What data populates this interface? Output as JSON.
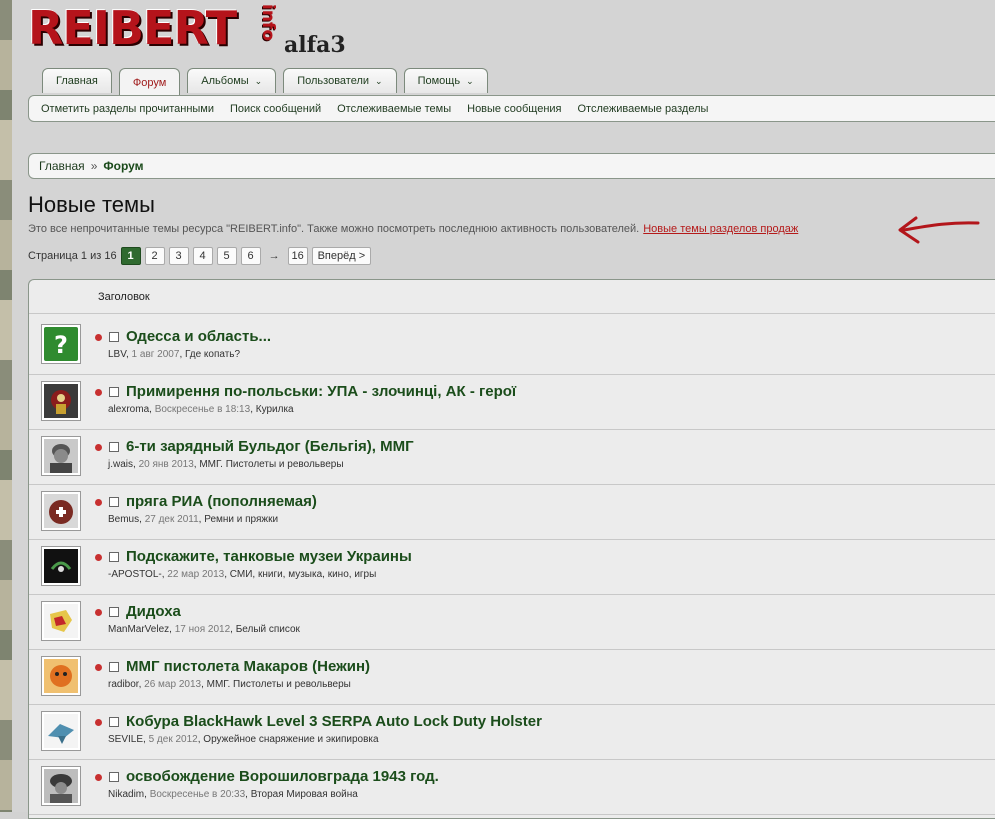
{
  "header": {
    "logo_main": "REIBERT",
    "logo_suffix": "info",
    "logo_tag": "alfa3"
  },
  "tabs": [
    {
      "label": "Главная",
      "dropdown": false,
      "active": false
    },
    {
      "label": "Форум",
      "dropdown": false,
      "active": true
    },
    {
      "label": "Альбомы",
      "dropdown": true,
      "active": false
    },
    {
      "label": "Пользователи",
      "dropdown": true,
      "active": false
    },
    {
      "label": "Помощь",
      "dropdown": true,
      "active": false
    }
  ],
  "subnav": [
    "Отметить разделы прочитанными",
    "Поиск сообщений",
    "Отслеживаемые темы",
    "Новые сообщения",
    "Отслеживаемые разделы"
  ],
  "breadcrumb": {
    "home": "Главная",
    "separator": "»",
    "current": "Форум"
  },
  "page": {
    "title": "Новые темы",
    "description": "Это все непрочитанные темы ресурса \"REIBERT.info\". Также можно посмотреть последнюю активность пользователей.",
    "sales_link": "Новые темы разделов продаж"
  },
  "pager": {
    "label": "Страница 1 из 16",
    "pages": [
      "1",
      "2",
      "3",
      "4",
      "5",
      "6"
    ],
    "current": "1",
    "ellipsis": "→",
    "last": "16",
    "next": "Вперёд >"
  },
  "list": {
    "header": "Заголовок",
    "threads": [
      {
        "title": "Одесса и область...",
        "author": "LBV",
        "date": "1 авг 2007",
        "forum": "Где копать?",
        "avatar": "question-icon"
      },
      {
        "title": "Примирення по-польськи: УПА - злочинці, АК - герої",
        "author": "alexroma",
        "date": "Воскресенье в 18:13",
        "forum": "Курилка",
        "avatar": "emblem-avatar"
      },
      {
        "title": "6-ти зарядный Бульдог (Бельгія), ММГ",
        "author": "j.wais",
        "date": "20 янв 2013",
        "forum": "ММГ. Пистолеты и револьверы",
        "avatar": "soldier-photo-avatar"
      },
      {
        "title": "пряга РИА (пополняемая)",
        "author": "Bemus",
        "date": "27 дек 2011",
        "forum": "Ремни и пряжки",
        "avatar": "badge-avatar"
      },
      {
        "title": "Подскажите, танковые музеи Украины",
        "author": "-APOSTOL-",
        "date": "22 мар 2013",
        "forum": "СМИ, книги, музыка, кино, игры",
        "avatar": "dark-emblem-avatar"
      },
      {
        "title": "Дидоха",
        "author": "ManMarVelez",
        "date": "17 ноя 2012",
        "forum": "Белый список",
        "avatar": "map-avatar"
      },
      {
        "title": "ММГ пистолета Макаров (Нежин)",
        "author": "radibor",
        "date": "26 мар 2013",
        "forum": "ММГ. Пистолеты и револьверы",
        "avatar": "cartoon-avatar"
      },
      {
        "title": "Кобура BlackHawk Level 3 SERPA Auto Lock Duty Holster",
        "author": "SEVILE",
        "date": "5 дек 2012",
        "forum": "Оружейное снаряжение и экипировка",
        "avatar": "shark-avatar"
      },
      {
        "title": "освобождение Ворошиловграда 1943 год.",
        "author": "Nikadim",
        "date": "Воскресенье в 20:33",
        "forum": "Вторая Мировая война",
        "avatar": "helmet-photo-avatar"
      }
    ]
  },
  "colors": {
    "accent_green": "#1b4d1b",
    "brand_red": "#b5141b",
    "unread_dot": "#c83030",
    "page_active": "#2f6a2f"
  }
}
